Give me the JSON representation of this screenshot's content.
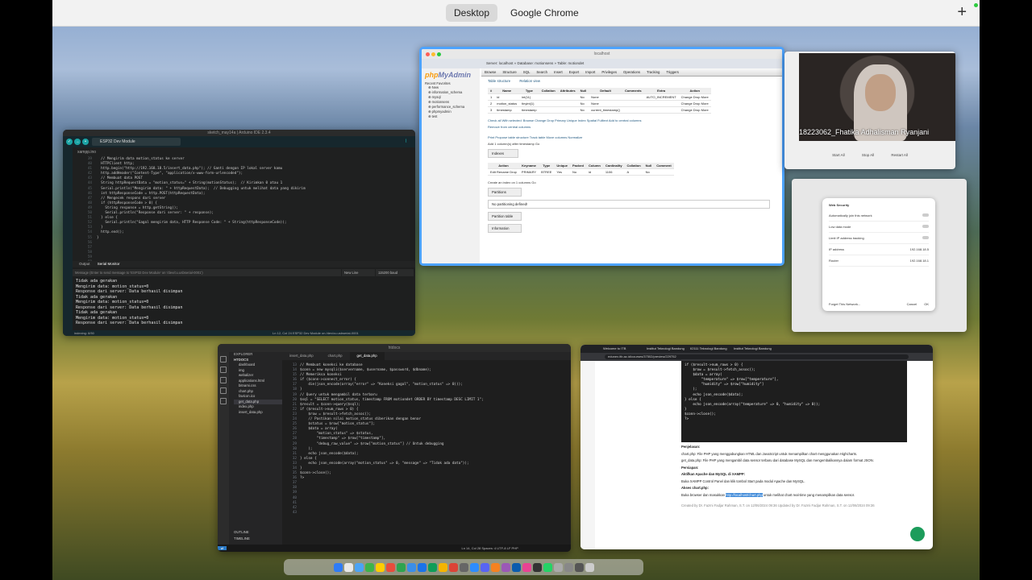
{
  "spaces": {
    "desktop": "Desktop",
    "chrome": "Google Chrome"
  },
  "arduino": {
    "title": "sketch_may14a | Arduino IDE 2.3.4",
    "board": "ESP32 Dev Module",
    "file": "xampp.ino",
    "line_numbers": [
      "39",
      "40",
      "41",
      "42",
      "43",
      "44",
      "45",
      "46",
      "47",
      "48",
      "49",
      "50",
      "51",
      "52",
      "53",
      "54",
      "55",
      "56",
      "57",
      "58",
      "59",
      "60"
    ],
    "code": [
      "  // Mengirim data motion_status ke server",
      "  HTTPClient http;",
      "  http.begin(\"http://192.168.18.5/insert_data.php\"); // Ganti dengan IP lokal server kamu",
      "  http.addHeader(\"Content-Type\", \"application/x-www-form-urlencoded\");",
      "",
      "  // Membuat data POST",
      "  String httpRequestData = \"motion_status=\" + String(motionStatus);  // Kirimkan 0 atau 1",
      "  Serial.println(\"Mengirim data: \" + httpRequestData);  // Debugging untuk melihat data yang dikirim",
      "",
      "  int httpResponseCode = http.POST(httpRequestData);",
      "",
      "  // Mengecek respons dari server",
      "  if (httpResponseCode > 0) {",
      "    String response = http.getString();",
      "    Serial.println(\"Response dari server: \" + response);",
      "  } else {",
      "    Serial.println(\"Gagal mengirim data, HTTP Response Code: \" + String(httpResponseCode));",
      "  }",
      "",
      "  http.end();",
      "}",
      ""
    ],
    "tabs": {
      "output": "Output",
      "serial": "Serial Monitor"
    },
    "message_placeholder": "Message (Enter to send message to 'ESP32 Dev Module' on '/dev/cu.usbserial-0001')",
    "line_ending": "New Line",
    "baud": "115200 baud",
    "serial": [
      "Tidak ada gerakan",
      "Mengirim data: motion_status=0",
      "Response dari server: Data berhasil disimpan",
      "Tidak ada gerakan",
      "Mengirim data: motion_status=0",
      "Response dari server: Data berhasil disimpan",
      "Tidak ada gerakan",
      "Mengirim data: motion_status=0",
      "Response dari server: Data berhasil disimpan"
    ],
    "status": "Ln 12, Col 24   ESP32 Dev Module on /dev/cu.usbserial-0001",
    "indexing": "indexing: 8/50"
  },
  "pma": {
    "url": "localhost",
    "breadcrumb": "Server: localhost » Database: motionsens » Table: motiondet",
    "logo_php": "php",
    "logo_my": "MyAdmin",
    "recent": "Recent   Favorites",
    "tree": [
      "New",
      "information_schema",
      "mysql",
      "motionsens",
      "performance_schema",
      "phpmyadmin",
      "test"
    ],
    "nav": [
      "Browse",
      "Structure",
      "SQL",
      "Search",
      "Insert",
      "Export",
      "Import",
      "Privileges",
      "Operations",
      "Tracking",
      "Triggers"
    ],
    "sub_nav": [
      "Table structure",
      "Relation view"
    ],
    "col_headers": [
      "#",
      "Name",
      "Type",
      "Collation",
      "Attributes",
      "Null",
      "Default",
      "Comments",
      "Extra",
      "Action"
    ],
    "rows": [
      [
        "1",
        "id",
        "int(11)",
        "",
        "",
        "No",
        "None",
        "",
        "AUTO_INCREMENT",
        "Change  Drop  More"
      ],
      [
        "2",
        "motion_status",
        "tinyint(1)",
        "",
        "",
        "No",
        "None",
        "",
        "",
        "Change  Drop  More"
      ],
      [
        "3",
        "timestamp",
        "timestamp",
        "",
        "",
        "No",
        "current_timestamp()",
        "",
        "",
        "Change  Drop  More"
      ]
    ],
    "actions": "Check all   With selected:  Browse  Change  Drop  Primary  Unique  Index  Spatial  Fulltext  Add to central columns",
    "remove_central": "Remove from central columns",
    "print_row": "Print   Propose table structure   Track table   Move columns   Normalize",
    "add_row": "Add  1  column(s)  after timestamp  Go",
    "indexes": "Indexes",
    "index_headers": [
      "Action",
      "Keyname",
      "Type",
      "Unique",
      "Packed",
      "Column",
      "Cardinality",
      "Collation",
      "Null",
      "Comment"
    ],
    "index_row": [
      "Edit  Rename  Drop",
      "PRIMARY",
      "BTREE",
      "Yes",
      "No",
      "id",
      "1106",
      "A",
      "No",
      ""
    ],
    "create_index": "Create an index on  1  columns  Go",
    "partitions": "Partitions",
    "no_partition": "No partitioning defined!",
    "partition_btn": "Partition table",
    "information": "Information"
  },
  "zoom": {
    "name": "18223062_Fhatika Adhalisman Ryanjani",
    "buttons": [
      "Start All",
      "Stop All",
      "Restart All"
    ]
  },
  "settings": {
    "title": "Web Security",
    "rows": [
      "Automatically join this network",
      "Low data mode",
      "Limit IP address tracking",
      "IP address",
      "Router"
    ],
    "values": [
      "",
      "",
      "",
      "192.168.18.5",
      "192.168.18.1"
    ],
    "forget": "Forget This Network...",
    "cancel": "Cancel",
    "ok": "OK"
  },
  "vscode": {
    "explorer_title": "EXPLORER",
    "folder": "HTDOCS",
    "files": [
      "dashboard",
      "img",
      "webalizer",
      "applications.html",
      "bitnami.css",
      "chart.php",
      "favicon.ico",
      "get_data.php",
      "index.php",
      "insert_data.php"
    ],
    "selected": "get_data.php",
    "outline": "OUTLINE",
    "timeline": "TIMELINE",
    "tabs": [
      "insert_data.php",
      "chart.php",
      "get_data.php"
    ],
    "line_numbers": [
      "13",
      "14",
      "15",
      "16",
      "17",
      "18",
      "19",
      "20",
      "21",
      "22",
      "23",
      "24",
      "25",
      "26",
      "27",
      "28",
      "29",
      "30",
      "31",
      "32",
      "33",
      "34",
      "35",
      "36",
      "37",
      "38",
      "39",
      "40",
      "41",
      "42",
      "43"
    ],
    "code": [
      "// Membuat koneksi ke database",
      "$conn = new mysqli($servername, $username, $password, $dbname);",
      "",
      "// Memeriksa koneksi",
      "if ($conn->connect_error) {",
      "    die(json_encode(array(\"error\" => \"Koneksi gagal\", \"motion_status\" => 0)));",
      "}",
      "",
      "// Query untuk mengambil data terbaru",
      "$sql = \"SELECT motion_status, timestamp FROM motiondet ORDER BY timestamp DESC LIMIT 1\";",
      "$result = $conn->query($sql);",
      "",
      "if ($result->num_rows > 0) {",
      "    $row = $result->fetch_assoc();",
      "    // Pastikan nilai motion_status diberikan dengan benar",
      "    $status = $row[\"motion_status\"];",
      "",
      "    $data = array(",
      "        \"motion_status\" => $status,",
      "        \"timestamp\" => $row[\"timestamp\"],",
      "        \"debug_raw_value\" => $row[\"motion_status\"] // Untuk debugging",
      "    );",
      "    echo json_encode($data);",
      "} else {",
      "    echo json_encode(array(\"motion_status\" => 0, \"message\" => \"Tidak ada data\"));",
      "}",
      "",
      "$conn->close();",
      "?>",
      "",
      ""
    ],
    "status": "Ln 14, Col 28   Spaces: 4   UTF-8   LF   PHP"
  },
  "chrome": {
    "tabs": [
      "Welcome to ITB",
      "Institut Teknologi Bandung",
      "II2111 Teknologi Bandung",
      "Institut Teknologi Bandung"
    ],
    "url": "edunex.itb.ac.id/courses/37502/preview/229752",
    "code": [
      "if ($result->num_rows > 0) {",
      "    $row = $result->fetch_assoc();",
      "    $data = array(",
      "        \"temperature\" => $row[\"temperature\"],",
      "        \"humidity\" => $row[\"humidity\"]",
      "    );",
      "    echo json_encode($data);",
      "} else {",
      "    echo json_encode(array(\"temperature\" => 0, \"humidity\" => 0));",
      "}",
      "",
      "$conn->close();",
      "?>"
    ],
    "penjelasan": "Penjelasan:",
    "bullet1": "chart.php: File PHP yang menggabungkan HTML dan JavaScript untuk menampilkan chart menggunakan Highcharts.",
    "bullet2": "get_data.php: File PHP yang mengambil data sensor terbaru dari database MySQL dan mengembalikannya dalam format JSON.",
    "persiapan": "Persiapan:",
    "aktifkan": "Aktifkan Apache dan MySQL di XAMPP:",
    "bullet3": "Buka XAMPP Control Panel dan klik tombol Start pada modul Apache dan MySQL.",
    "akses": "Akses chart.php:",
    "bullet4_pre": "Buka browser dan masukkan",
    "bullet4_link": "http://localhost/chart.php",
    "bullet4_post": "untuk melihat chart real-time yang menampilkan data sensor.",
    "footer": "Created by Dr. Fazmi Fadjar Rahman, S.T. on 12/06/2024 09:36     Updated by Dr. Fazmi Fadjar Rahman, S.T. on 12/06/2024 09:36"
  }
}
